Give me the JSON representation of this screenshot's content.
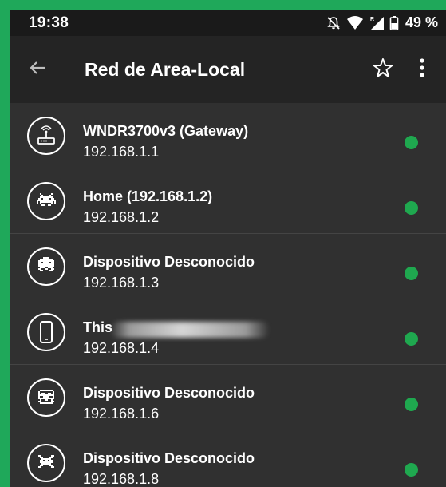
{
  "status_bar": {
    "time": "19:38",
    "battery": "49 %"
  },
  "app_bar": {
    "title": "Red de Area-Local"
  },
  "devices": [
    {
      "name": "WNDR3700v3 (Gateway)",
      "ip": "192.168.1.1",
      "icon": "router-icon",
      "status": "online"
    },
    {
      "name": "Home (192.168.1.2)",
      "ip": "192.168.1.2",
      "icon": "space-invader-icon",
      "status": "online"
    },
    {
      "name": "Dispositivo Desconocido",
      "ip": "192.168.1.3",
      "icon": "space-invader-icon",
      "status": "online"
    },
    {
      "name": "This",
      "ip": "192.168.1.4",
      "icon": "phone-icon",
      "status": "online"
    },
    {
      "name": "Dispositivo Desconocido",
      "ip": "192.168.1.6",
      "icon": "space-invader-icon",
      "status": "online"
    },
    {
      "name": "Dispositivo Desconocido",
      "ip": "192.168.1.8",
      "icon": "space-invader-icon",
      "status": "online"
    }
  ],
  "colors": {
    "background": "#303030",
    "app_bar": "#242424",
    "status_bar": "#1a1a1a",
    "online_dot": "#1fa84f",
    "outer_border": "#1fa85a"
  }
}
